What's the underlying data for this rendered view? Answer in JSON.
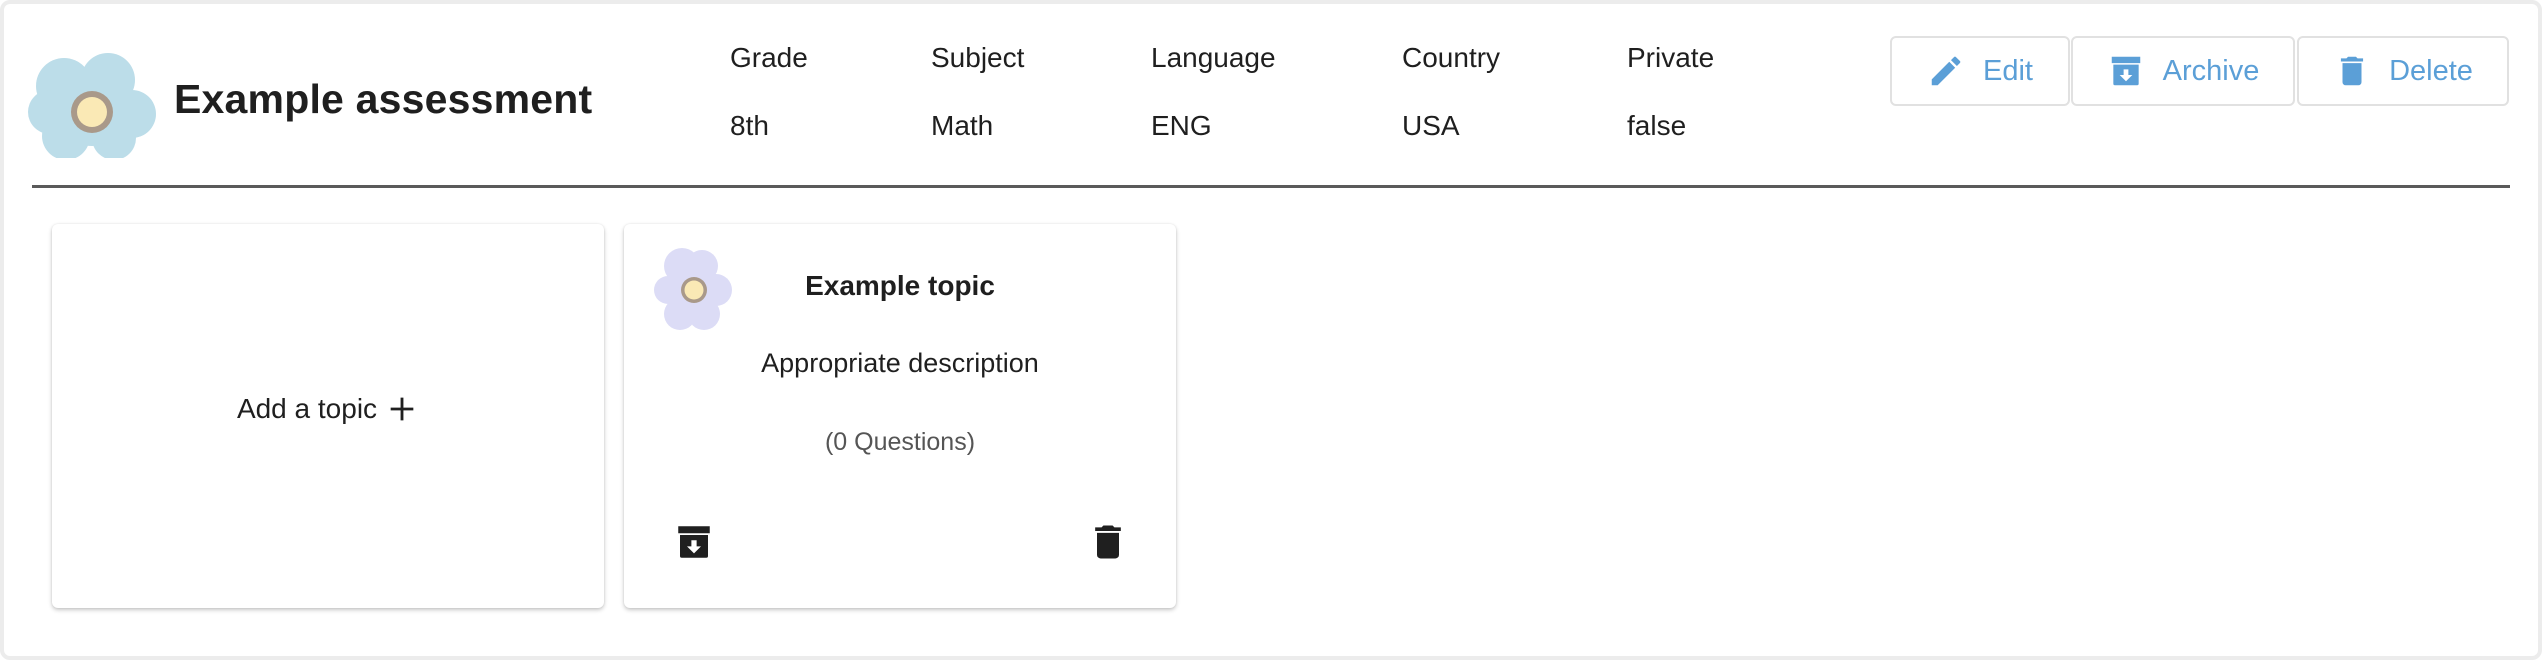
{
  "assessment": {
    "title": "Example assessment",
    "meta": [
      {
        "label": "Grade",
        "value": "8th"
      },
      {
        "label": "Subject",
        "value": "Math"
      },
      {
        "label": "Language",
        "value": "ENG"
      },
      {
        "label": "Country",
        "value": "USA"
      },
      {
        "label": "Private",
        "value": "false"
      }
    ]
  },
  "actions": {
    "edit_label": "Edit",
    "archive_label": "Archive",
    "delete_label": "Delete"
  },
  "add_topic": {
    "label": "Add a topic"
  },
  "topics": [
    {
      "title": "Example topic",
      "description": "Appropriate description",
      "count": "(0 Questions)"
    }
  ],
  "icons": {
    "logo": "flower-icon",
    "edit": "pencil-icon",
    "archive": "archive-icon",
    "delete": "trash-icon",
    "add": "plus-icon"
  },
  "colors": {
    "accent": "#5b9fd7",
    "flower_primary": "#bcdde9",
    "flower_topic": "#dcdcf6",
    "flower_center": "#fae9b5",
    "flower_ring": "#a9998a",
    "divider": "#5a5a5a"
  }
}
